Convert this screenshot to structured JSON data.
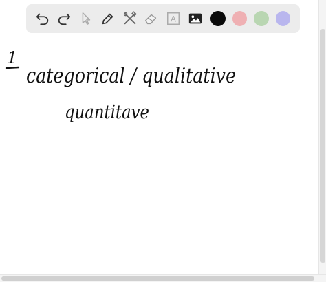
{
  "toolbar": {
    "tools": [
      {
        "name": "undo-icon"
      },
      {
        "name": "redo-icon"
      },
      {
        "name": "pointer-icon"
      },
      {
        "name": "pen-icon"
      },
      {
        "name": "tools-icon"
      },
      {
        "name": "eraser-icon"
      },
      {
        "name": "text-icon",
        "label": "A"
      },
      {
        "name": "image-icon"
      }
    ],
    "colors": [
      "#0a0a0a",
      "#efb0b3",
      "#b9d6b2",
      "#b9b6ee"
    ]
  },
  "canvas": {
    "number": "1",
    "line1": "categorical / qualitative",
    "line2": "quantitave"
  }
}
